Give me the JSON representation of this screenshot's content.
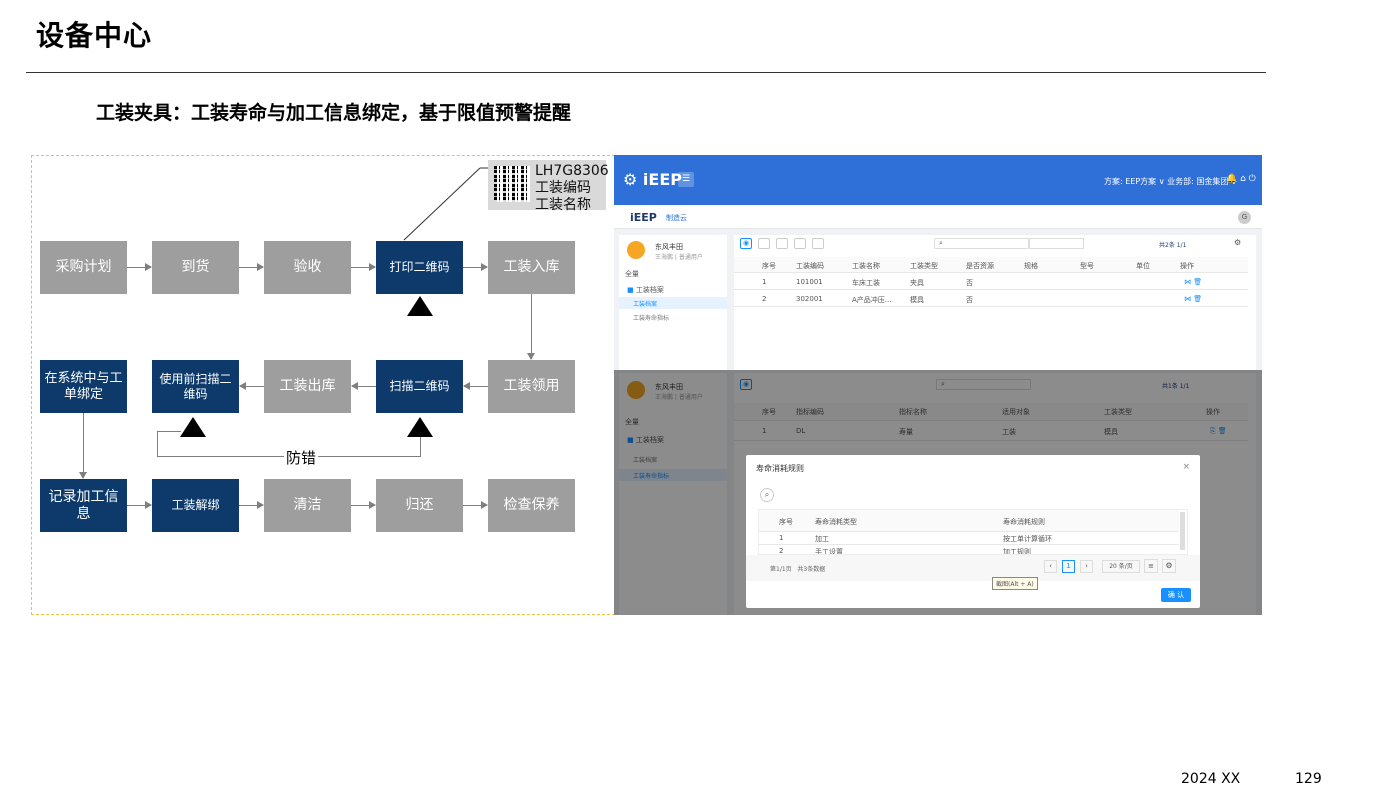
{
  "page": {
    "title": "设备中心",
    "subtitle": "工装夹具：工装寿命与加工信息绑定，基于限值预警提醒",
    "footer_year": "2024 XX",
    "page_number": "129"
  },
  "callout": {
    "line1": "LH7G8306",
    "line2": "工装编码",
    "line3": "工装名称"
  },
  "flow": {
    "row1": [
      "采购计划",
      "到货",
      "验收",
      "打印二维码",
      "工装入库"
    ],
    "row2": [
      "在系统中与工单绑定",
      "使用前扫描二维码",
      "工装出库",
      "扫描二维码",
      "工装领用"
    ],
    "row3": [
      "记录加工信息",
      "工装解绑",
      "清洁",
      "归还",
      "检查保养"
    ],
    "loop_label": "防错"
  },
  "app": {
    "logo": "iEEP",
    "header_right": "方案: EEP方案 ∨   业务部: 国金集团 ∨",
    "subbar_logo": "iEEP",
    "subbar_tab": "制造云",
    "top_view": {
      "user": "东风丰田",
      "user_sub": "王海鹏 | 普通用户",
      "tree_root": "全量",
      "tree_group": "工装档案",
      "tree_items": [
        "工装档案",
        "工装寿命指标"
      ],
      "pager": "共2条 1/1",
      "columns": [
        "序号",
        "工装编码",
        "工装名称",
        "工装类型",
        "是否资源",
        "规格",
        "型号",
        "单位",
        "操作"
      ],
      "rows": [
        [
          "1",
          "101001",
          "车床工装",
          "夹具",
          "否"
        ],
        [
          "2",
          "302001",
          "A产品冲压...",
          "模具",
          "否"
        ]
      ]
    },
    "bottom_view": {
      "user": "东风丰田",
      "user_sub": "王海鹏 | 普通用户",
      "tree_root": "全量",
      "tree_group": "工装档案",
      "tree_items": [
        "工装档案",
        "工装寿命指标"
      ],
      "pager": "共1条 1/1",
      "columns": [
        "序号",
        "指标编码",
        "指标名称",
        "适用对象",
        "工装类型",
        "操作"
      ],
      "rows": [
        [
          "1",
          "DL",
          "寿量",
          "工装",
          "模具"
        ]
      ]
    },
    "modal": {
      "title": "寿命消耗规则",
      "columns": [
        "序号",
        "寿命消耗类型",
        "寿命消耗规则"
      ],
      "rows": [
        [
          "1",
          "加工",
          "按工单计算循环"
        ],
        [
          "2",
          "手工设置",
          "加工规则"
        ]
      ],
      "pager_left": "第1/1页   共3条数据",
      "page_num": "1",
      "page_size": "20 条/页",
      "tooltip": "截图(Alt + A)",
      "confirm": "确 认"
    }
  },
  "colors": {
    "navy": "#0d3a6b",
    "gray_box": "#9e9e9e",
    "app_blue": "#2e6fd8"
  }
}
